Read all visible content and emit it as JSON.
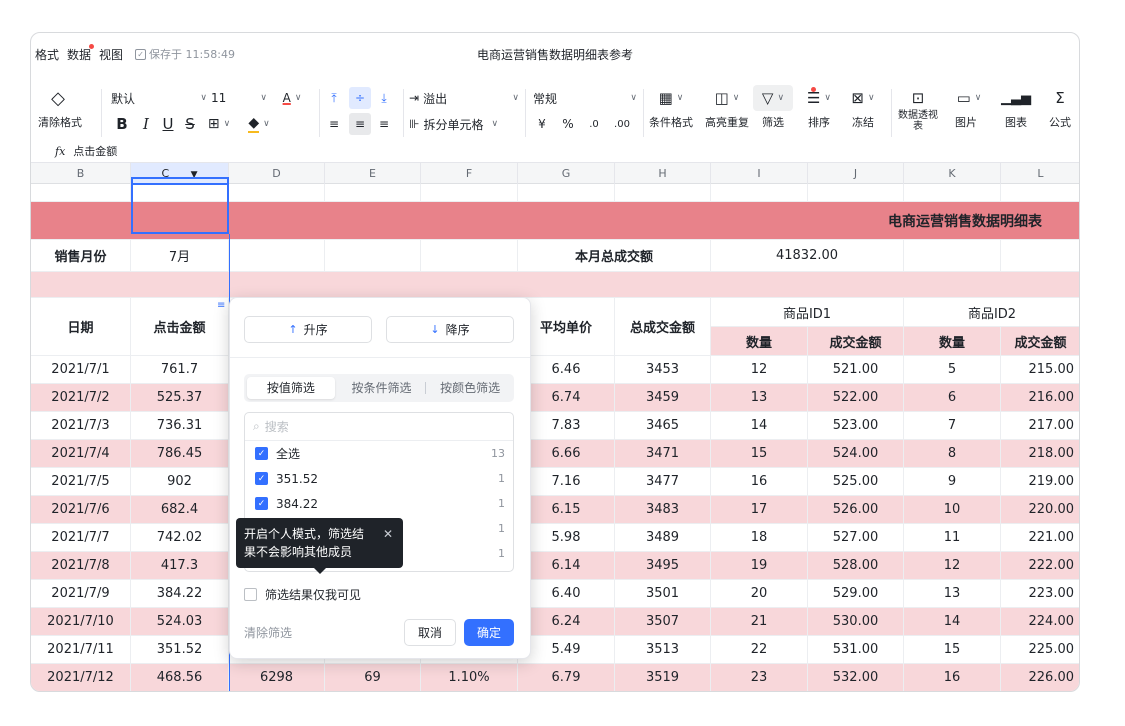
{
  "menu": {
    "items": [
      "格式",
      "数据",
      "视图"
    ],
    "saved_text": "保存于 11:58:49"
  },
  "document_title": "电商运营销售数据明细表参考",
  "toolbar": {
    "clear_format": "清除格式",
    "font_name": "默认",
    "font_size": "11",
    "overflow": "溢出",
    "split_cells": "拆分单元格",
    "number_format": "常规",
    "conditional_format": "条件格式",
    "highlight_duplicates": "高亮重复",
    "filter": "筛选",
    "sort": "排序",
    "freeze": "冻结",
    "pivot_table": "数据透视表",
    "image": "图片",
    "chart": "图表",
    "formula": "公式"
  },
  "formula_bar": {
    "label": "fx",
    "content": "点击金额"
  },
  "columns": [
    "B",
    "C",
    "D",
    "E",
    "F",
    "G",
    "H",
    "I",
    "J",
    "K",
    "L"
  ],
  "sheet": {
    "banner_title": "电商运营销售数据明细表",
    "sales_month_label": "销售月份",
    "sales_month_value": "7月",
    "total_label": "本月总成交额",
    "total_value": "41832.00",
    "headers": {
      "date": "日期",
      "click_amount": "点击金额",
      "avg_price": "平均单价",
      "total_amount": "总成交金额",
      "product1": "商品ID1",
      "product2": "商品ID2",
      "qty": "数量",
      "amount": "成交金额"
    },
    "rows": [
      {
        "date": "2021/7/1",
        "click": "761.7",
        "d": "",
        "e": "",
        "f": "",
        "g": "6.46",
        "h": "3453",
        "i": "12",
        "j": "521.00",
        "k": "5",
        "l": "215.00"
      },
      {
        "date": "2021/7/2",
        "click": "525.37",
        "d": "",
        "e": "",
        "f": "",
        "g": "6.74",
        "h": "3459",
        "i": "13",
        "j": "522.00",
        "k": "6",
        "l": "216.00"
      },
      {
        "date": "2021/7/3",
        "click": "736.31",
        "d": "",
        "e": "",
        "f": "",
        "g": "7.83",
        "h": "3465",
        "i": "14",
        "j": "523.00",
        "k": "7",
        "l": "217.00"
      },
      {
        "date": "2021/7/4",
        "click": "786.45",
        "d": "",
        "e": "",
        "f": "",
        "g": "6.66",
        "h": "3471",
        "i": "15",
        "j": "524.00",
        "k": "8",
        "l": "218.00"
      },
      {
        "date": "2021/7/5",
        "click": "902",
        "d": "",
        "e": "",
        "f": "",
        "g": "7.16",
        "h": "3477",
        "i": "16",
        "j": "525.00",
        "k": "9",
        "l": "219.00"
      },
      {
        "date": "2021/7/6",
        "click": "682.4",
        "d": "",
        "e": "",
        "f": "",
        "g": "6.15",
        "h": "3483",
        "i": "17",
        "j": "526.00",
        "k": "10",
        "l": "220.00"
      },
      {
        "date": "2021/7/7",
        "click": "742.02",
        "d": "",
        "e": "",
        "f": "",
        "g": "5.98",
        "h": "3489",
        "i": "18",
        "j": "527.00",
        "k": "11",
        "l": "221.00"
      },
      {
        "date": "2021/7/8",
        "click": "417.3",
        "d": "",
        "e": "",
        "f": "",
        "g": "6.14",
        "h": "3495",
        "i": "19",
        "j": "528.00",
        "k": "12",
        "l": "222.00"
      },
      {
        "date": "2021/7/9",
        "click": "384.22",
        "d": "",
        "e": "",
        "f": "",
        "g": "6.40",
        "h": "3501",
        "i": "20",
        "j": "529.00",
        "k": "13",
        "l": "223.00"
      },
      {
        "date": "2021/7/10",
        "click": "524.03",
        "d": "",
        "e": "",
        "f": "",
        "g": "6.24",
        "h": "3507",
        "i": "21",
        "j": "530.00",
        "k": "14",
        "l": "224.00"
      },
      {
        "date": "2021/7/11",
        "click": "351.52",
        "d": "",
        "e": "",
        "f": "",
        "g": "5.49",
        "h": "3513",
        "i": "22",
        "j": "531.00",
        "k": "15",
        "l": "225.00"
      },
      {
        "date": "2021/7/12",
        "click": "468.56",
        "d": "6298",
        "e": "69",
        "f": "1.10%",
        "g": "6.79",
        "h": "3519",
        "i": "23",
        "j": "532.00",
        "k": "16",
        "l": "226.00"
      }
    ]
  },
  "filter_popup": {
    "sort_asc": "升序",
    "sort_desc": "降序",
    "tabs": [
      "按值筛选",
      "按条件筛选",
      "按颜色筛选"
    ],
    "search_placeholder": "搜索",
    "items": [
      {
        "label": "全选",
        "count": "13",
        "checked": true
      },
      {
        "label": "351.52",
        "count": "1",
        "checked": true
      },
      {
        "label": "384.22",
        "count": "1",
        "checked": true
      },
      {
        "label": "",
        "count": "1",
        "checked": true
      },
      {
        "label": "",
        "count": "1",
        "checked": true
      }
    ],
    "only_me": "筛选结果仅我可见",
    "clear": "清除筛选",
    "cancel": "取消",
    "confirm": "确定"
  },
  "tooltip": {
    "text": "开启个人模式，筛选结果不会影响其他成员"
  },
  "colors": {
    "accent": "#3370ff",
    "banner": "#e8828a",
    "pink_row": "#f8d7da"
  }
}
